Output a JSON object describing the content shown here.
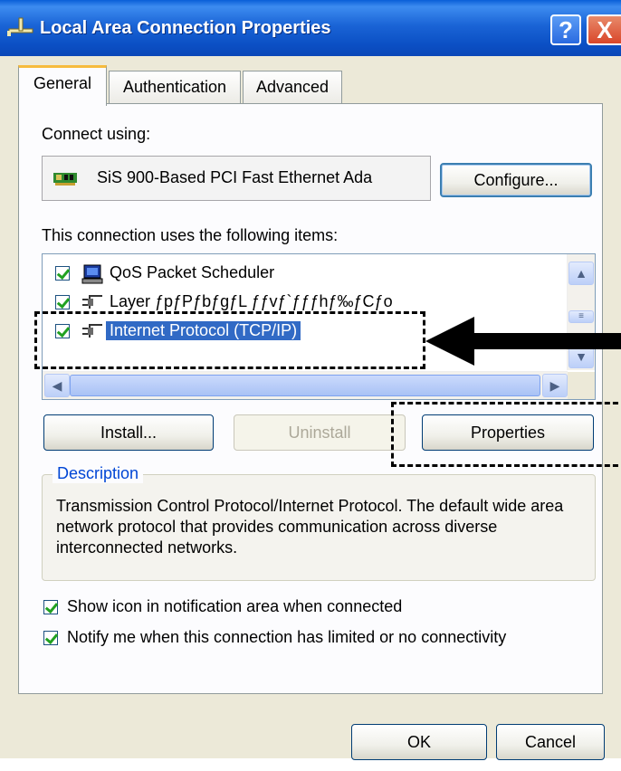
{
  "window": {
    "title": "Local Area Connection Properties"
  },
  "titlebar_buttons": {
    "help": "?",
    "close": "X"
  },
  "tabs": [
    {
      "label": "General",
      "active": true
    },
    {
      "label": "Authentication",
      "active": false
    },
    {
      "label": "Advanced",
      "active": false
    }
  ],
  "connect_using": {
    "label": "Connect using:",
    "adapter": "SiS 900-Based PCI Fast Ethernet Ada",
    "adapter_icon": "network-card-icon",
    "configure_button": "Configure..."
  },
  "items": {
    "label": "This connection uses the following items:",
    "list": [
      {
        "text": "QoS Packet Scheduler",
        "checked": true,
        "icon": "scheduler-icon",
        "selected": false
      },
      {
        "text": "Layer ƒpƒPƒbƒgƒL ƒƒvƒ`ƒƒƒhƒ‰ƒCƒo",
        "checked": true,
        "icon": "protocol-icon",
        "selected": false
      },
      {
        "text": "Internet Protocol (TCP/IP)",
        "checked": true,
        "icon": "protocol-icon",
        "selected": true
      }
    ],
    "install_button": "Install...",
    "uninstall_button": "Uninstall",
    "properties_button": "Properties"
  },
  "description": {
    "legend": "Description",
    "text": "Transmission Control Protocol/Internet Protocol. The default wide area network protocol that provides communication across diverse interconnected networks."
  },
  "options": [
    {
      "label": "Show icon in notification area when connected",
      "checked": true
    },
    {
      "label": "Notify me when this connection has limited or no connectivity",
      "checked": true
    }
  ],
  "footer": {
    "ok_button": "OK",
    "cancel_button": "Cancel"
  },
  "colors": {
    "titlebar": "#0b4fc4",
    "selection": "#316ac5",
    "dialog_bg": "#ece9d8",
    "legend": "#0046d5"
  }
}
